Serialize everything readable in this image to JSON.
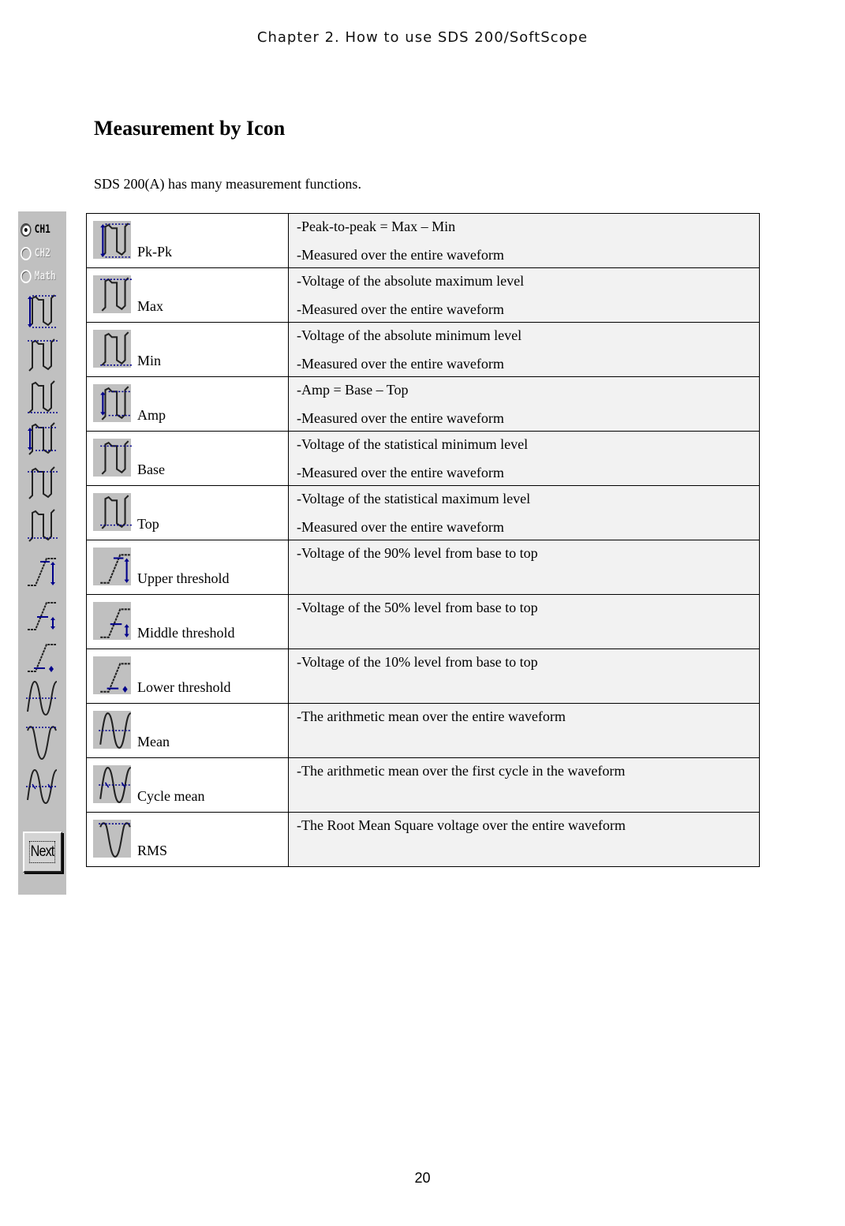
{
  "running_head": "Chapter 2. How to use SDS 200/SoftScope",
  "section_title": "Measurement by Icon",
  "intro": "SDS 200(A) has many measurement functions.",
  "toolbar": {
    "channels": [
      {
        "label": "CH1",
        "selected": true,
        "enabled": true
      },
      {
        "label": "CH2",
        "selected": false,
        "enabled": false
      },
      {
        "label": "Math",
        "selected": false,
        "enabled": false
      }
    ],
    "icons": [
      "pk-pk-icon",
      "max-icon",
      "min-icon",
      "amp-icon",
      "base-icon",
      "top-icon",
      "upper-threshold-icon",
      "middle-threshold-icon",
      "lower-threshold-icon",
      "mean-icon",
      "rms-icon",
      "cycle-mean-icon"
    ],
    "next_label": "Next"
  },
  "colors": {
    "icon_bg": "#c0c0c0",
    "marker_blue": "#00008b",
    "desc_bg": "#f2f2f2"
  },
  "measurements": [
    {
      "name": "Pk-Pk",
      "icon": "pk-pk-icon",
      "desc": [
        "-Peak-to-peak = Max – Min",
        "-Measured over the entire waveform"
      ]
    },
    {
      "name": "Max",
      "icon": "max-icon",
      "desc": [
        "-Voltage of the absolute maximum level",
        "-Measured over the entire waveform"
      ]
    },
    {
      "name": "Min",
      "icon": "min-icon",
      "desc": [
        "-Voltage of the absolute minimum level",
        "-Measured over the entire waveform"
      ]
    },
    {
      "name": "Amp",
      "icon": "amp-icon",
      "desc": [
        "-Amp = Base – Top",
        "-Measured over the entire waveform"
      ]
    },
    {
      "name": "Base",
      "icon": "base-icon",
      "desc": [
        "-Voltage of the statistical minimum level",
        "-Measured over the entire waveform"
      ]
    },
    {
      "name": "Top",
      "icon": "top-icon",
      "desc": [
        "-Voltage of the statistical maximum level",
        "-Measured over the entire waveform"
      ]
    },
    {
      "name": "Upper threshold",
      "icon": "upper-threshold-icon",
      "desc": [
        "-Voltage of the 90% level from base to top"
      ]
    },
    {
      "name": "Middle threshold",
      "icon": "middle-threshold-icon",
      "desc": [
        "-Voltage of the 50% level from base to top"
      ]
    },
    {
      "name": "Lower threshold",
      "icon": "lower-threshold-icon",
      "desc": [
        "-Voltage of the 10% level from base to top"
      ]
    },
    {
      "name": "Mean",
      "icon": "mean-icon",
      "desc": [
        "-The arithmetic mean over the entire waveform"
      ]
    },
    {
      "name": "Cycle mean",
      "icon": "cycle-mean-icon",
      "desc": [
        "-The arithmetic mean over the first cycle in the waveform"
      ]
    },
    {
      "name": "RMS",
      "icon": "rms-icon",
      "desc": [
        "-The Root Mean Square voltage over the entire waveform"
      ]
    }
  ],
  "page_number": "20"
}
